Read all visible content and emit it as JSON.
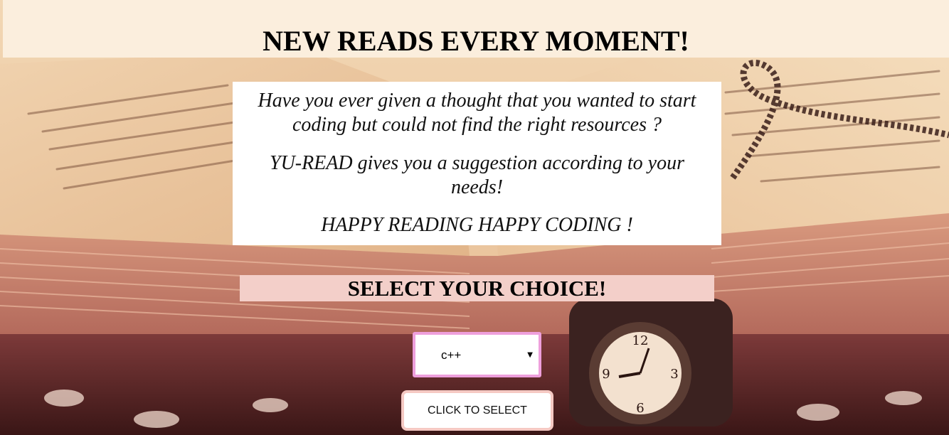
{
  "header": {
    "title": "NEW READS EVERY MOMENT!"
  },
  "intro": {
    "line1": "Have you ever given a thought that you wanted to start coding but could not find the right resources ?",
    "line2": "YU-READ gives you a suggestion according to your needs!",
    "line3": "HAPPY READING HAPPY CODING !"
  },
  "selection": {
    "title": "SELECT YOUR CHOICE!",
    "selected": "c++",
    "options": [
      "c++"
    ],
    "button_label": "CLICK TO SELECT"
  },
  "colors": {
    "header_bg": "#fbeedd",
    "select_title_bg": "#f3cfc9",
    "select_border": "#ee9fdc",
    "button_border": "#f5c9c3"
  }
}
